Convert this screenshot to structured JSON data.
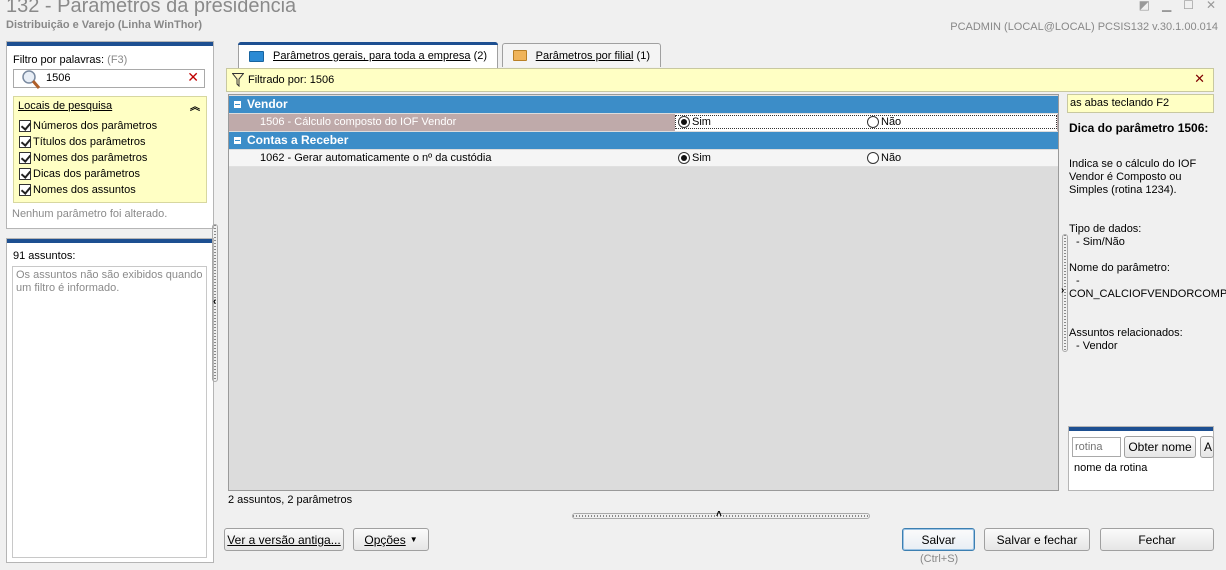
{
  "window": {
    "title": "132 - Parâmetros da presidência",
    "subtitle": "Distribuição e Varejo (Linha WinThor)",
    "user_info": "PCADMIN (LOCAL@LOCAL)   PCSIS132  v.30.1.00.014"
  },
  "left": {
    "filter_label": "Filtro por palavras:",
    "filter_shortcut": "(F3)",
    "search_value": "1506",
    "locais_title": "Locais de pesquisa",
    "locais_items": [
      {
        "label": "Números dos parâmetros",
        "checked": true
      },
      {
        "label": "Títulos dos parâmetros",
        "checked": true
      },
      {
        "label": "Nomes dos parâmetros",
        "checked": true
      },
      {
        "label": "Dicas dos parâmetros",
        "checked": true
      },
      {
        "label": "Nomes dos assuntos",
        "checked": true
      }
    ],
    "no_change_msg": "Nenhum parâmetro foi alterado.",
    "assuntos_count": "91 assuntos:",
    "assuntos_msg": "Os assuntos não são exibidos quando um filtro é informado."
  },
  "tabs": [
    {
      "label": "Parâmetros gerais, para toda a empresa",
      "count": "(2)",
      "active": true
    },
    {
      "label": "Parâmetros por filial",
      "count": "(1)",
      "active": false
    }
  ],
  "filter": {
    "label": "Filtrado por: 1506"
  },
  "grid": {
    "groups": [
      {
        "name": "Vendor",
        "rows": [
          {
            "label": "1506 - Cálculo composto do IOF Vendor",
            "yes": "Sim",
            "no": "Não",
            "value": "Sim",
            "selected": true
          }
        ]
      },
      {
        "name": "Contas a Receber",
        "rows": [
          {
            "label": "1062 - Gerar automaticamente o nº da custódia",
            "yes": "Sim",
            "no": "Não",
            "value": "Sim",
            "selected": false
          }
        ]
      }
    ],
    "footer": "2 assuntos, 2 parâmetros"
  },
  "right": {
    "tip_bar": "as abas teclando F2",
    "tip_title": "Dica do parâmetro 1506:",
    "tip_desc": [
      "Indica se o cálculo do IOF",
      "Vendor é Composto ou",
      "Simples (rotina 1234)."
    ],
    "type_label": "Tipo de dados:",
    "type_value": "- Sim/Não",
    "param_name_label": "Nome do parâmetro:",
    "param_name_dash": "-",
    "param_name_value": "CON_CALCIOFVENDORCOMP",
    "related_label": "Assuntos relacionados:",
    "related_value": "- Vendor",
    "rotina_placeholder": "rotina",
    "get_name_button": "Obter nome",
    "partial_button": "A",
    "rotina_name": "nome da rotina"
  },
  "bottom": {
    "old_version": "Ver a versão antiga...",
    "options": "Opções",
    "save": "Salvar",
    "save_shortcut": "(Ctrl+S)",
    "save_close": "Salvar e fechar",
    "close": "Fechar"
  }
}
